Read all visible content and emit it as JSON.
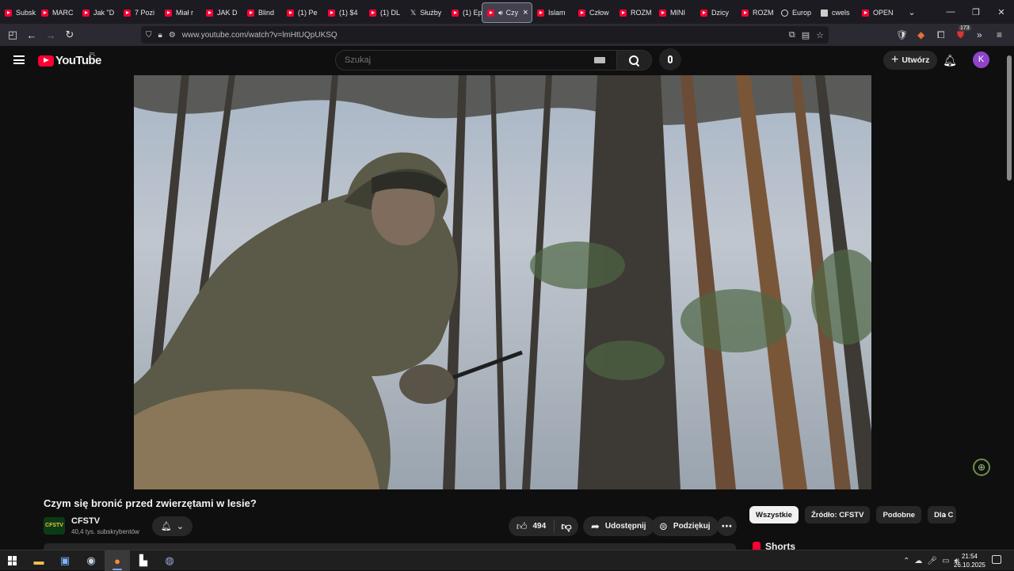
{
  "browser": {
    "tabs": [
      {
        "label": "Subsk",
        "icon": "youtube-icon"
      },
      {
        "label": "MARC",
        "icon": "youtube-icon"
      },
      {
        "label": "Jak \"D",
        "icon": "youtube-icon"
      },
      {
        "label": "7 Pozi",
        "icon": "youtube-icon"
      },
      {
        "label": "Miał r",
        "icon": "youtube-icon"
      },
      {
        "label": "JAK D",
        "icon": "youtube-icon"
      },
      {
        "label": "Blind",
        "icon": "youtube-icon"
      },
      {
        "label": "(1) Pe",
        "icon": "youtube-icon"
      },
      {
        "label": "(1) $4",
        "icon": "youtube-icon"
      },
      {
        "label": "(1) DL",
        "icon": "youtube-icon"
      },
      {
        "label": "Służby",
        "icon": "x-icon"
      },
      {
        "label": "(1) Ep",
        "icon": "youtube-icon"
      },
      {
        "label": "Czy",
        "icon": "youtube-icon",
        "active": true
      },
      {
        "label": "Islam",
        "icon": "youtube-icon"
      },
      {
        "label": "Człow",
        "icon": "youtube-icon"
      },
      {
        "label": "ROZM",
        "icon": "youtube-icon"
      },
      {
        "label": "MINI",
        "icon": "youtube-icon"
      },
      {
        "label": "Dzicy",
        "icon": "youtube-icon"
      },
      {
        "label": "ROZM",
        "icon": "youtube-icon"
      },
      {
        "label": "Europ",
        "icon": "globe-icon"
      },
      {
        "label": "cwels",
        "icon": "grid-icon"
      },
      {
        "label": "OPEN",
        "icon": "youtube-icon"
      }
    ],
    "url": "www.youtube.com/watch?v=lmHtUQpUKSQ",
    "extension_badge": "173",
    "window_controls": {
      "minimize": "—",
      "restore": "❐",
      "close": "✕"
    }
  },
  "youtube": {
    "logo_text": "YouTube",
    "country_code": "PL",
    "search_placeholder": "Szukaj",
    "create_label": "Utwórz",
    "avatar_letter": "K",
    "accent_color": "#ff0033"
  },
  "video": {
    "title": "Czym się bronić przed zwierzętami w lesie?",
    "channel": {
      "name": "CFSTV",
      "subscribers": "40,4 tys. subskrybentów",
      "avatar_text": "CFSTV"
    },
    "likes": "494",
    "share_label": "Udostępnij",
    "thanks_label": "Podziękuj"
  },
  "sidebar": {
    "chips": [
      "Wszystkie",
      "Źródło: CFSTV",
      "Podobne",
      "Dla C"
    ],
    "section_title": "Shorts"
  },
  "taskbar": {
    "time": "21:54",
    "date": "26.10.2025"
  }
}
